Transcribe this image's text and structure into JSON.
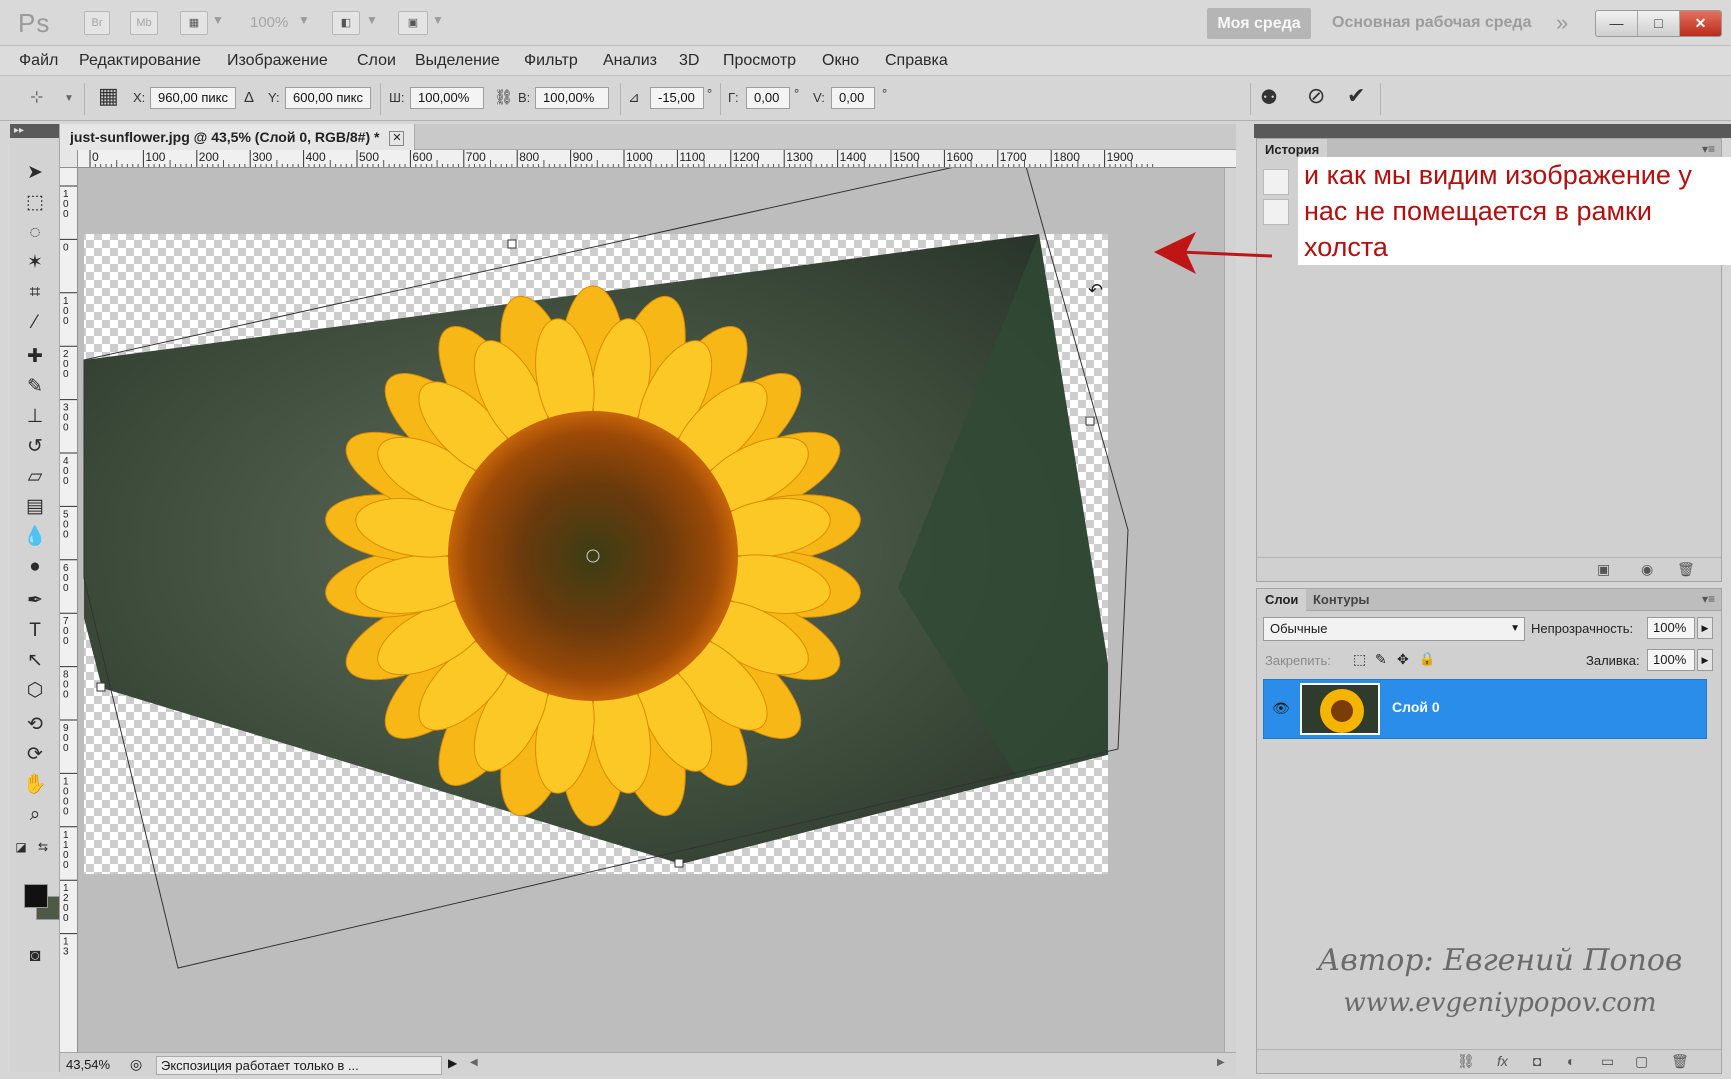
{
  "titlebar": {
    "app_logo": "Ps",
    "btn_bridge": "Br",
    "btn_mini_bridge": "Mb",
    "zoom_level": "100%",
    "workspace_active": "Моя среда",
    "workspace_other": "Основная рабочая среда",
    "more_icon": "»",
    "minimize_icon": "—",
    "maximize_icon": "□",
    "close_icon": "✕"
  },
  "menu": [
    "Файл",
    "Редактирование",
    "Изображение",
    "Слои",
    "Выделение",
    "Фильтр",
    "Анализ",
    "3D",
    "Просмотр",
    "Окно",
    "Справка"
  ],
  "options": {
    "x_label": "X:",
    "x_value": "960,00 пикс",
    "y_label": "Y:",
    "y_value": "600,00 пикс",
    "w_label": "Ш:",
    "w_value": "100,00%",
    "h_label": "В:",
    "h_value": "100,00%",
    "angle_value": "-15,00",
    "h_skew_label": "Г:",
    "h_skew_value": "0,00",
    "v_skew_label": "V:",
    "v_skew_value": "0,00",
    "degree": "°"
  },
  "document": {
    "tab_title": "just-sunflower.jpg @ 43,5% (Слой 0, RGB/8#) *",
    "tab_close": "✕",
    "status_zoom": "43,54%",
    "status_message": "Экспозиция работает только в ..."
  },
  "ruler": {
    "top_ticks": [
      "0",
      "100",
      "200",
      "300",
      "400",
      "500",
      "600",
      "700",
      "800",
      "900",
      "1000",
      "1100",
      "1200",
      "1300",
      "1400",
      "1500",
      "1600",
      "1700",
      "1800",
      "1900"
    ],
    "left_ticks": [
      "1\n0\n0",
      "0",
      "1\n0\n0",
      "2\n0\n0",
      "3\n0\n0",
      "4\n0\n0",
      "5\n0\n0",
      "6\n0\n0",
      "7\n0\n0",
      "8\n0\n0",
      "9\n0\n0",
      "1\n0\n0\n0",
      "1\n1\n0\n0",
      "1\n2\n0\n0",
      "1\n3"
    ]
  },
  "panels": {
    "history_tab": "История",
    "layers_tab": "Слои",
    "paths_tab": "Контуры",
    "blend_mode": "Обычные",
    "opacity_label": "Непрозрачность:",
    "opacity_value": "100%",
    "lock_label": "Закрепить:",
    "fill_label": "Заливка:",
    "fill_value": "100%",
    "layer_name": "Слой 0"
  },
  "annotation": {
    "callout_text": "и как мы видим изображение у нас не помещается в рамки холста",
    "arrow_color": "#c01515",
    "watermark_line1": "Автор: Евгений Попов",
    "watermark_line2": "www.evgeniypopov.com"
  },
  "colors": {
    "selected_layer": "#2a8dea",
    "foreground": "#111111",
    "background": "#4e5a46",
    "callout_text": "#b30f0f"
  }
}
